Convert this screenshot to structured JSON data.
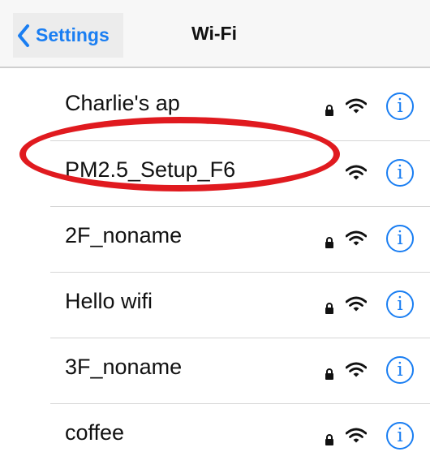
{
  "navbar": {
    "back_label": "Settings",
    "title": "Wi-Fi",
    "accent_color": "#1a7ef2"
  },
  "networks": [
    {
      "ssid": "Charlie's ap",
      "secured": true,
      "signal_icon": "wifi-icon",
      "info_glyph": "i"
    },
    {
      "ssid": "PM2.5_Setup_F6",
      "secured": false,
      "signal_icon": "wifi-icon",
      "info_glyph": "i",
      "highlighted": true
    },
    {
      "ssid": "2F_noname",
      "secured": true,
      "signal_icon": "wifi-icon",
      "info_glyph": "i"
    },
    {
      "ssid": "Hello wifi",
      "secured": true,
      "signal_icon": "wifi-icon",
      "info_glyph": "i"
    },
    {
      "ssid": "3F_noname",
      "secured": true,
      "signal_icon": "wifi-icon",
      "info_glyph": "i"
    },
    {
      "ssid": "coffee",
      "secured": true,
      "signal_icon": "wifi-icon",
      "info_glyph": "i"
    }
  ],
  "annotation": {
    "color": "#e01a1f",
    "target": "PM2.5_Setup_F6"
  }
}
